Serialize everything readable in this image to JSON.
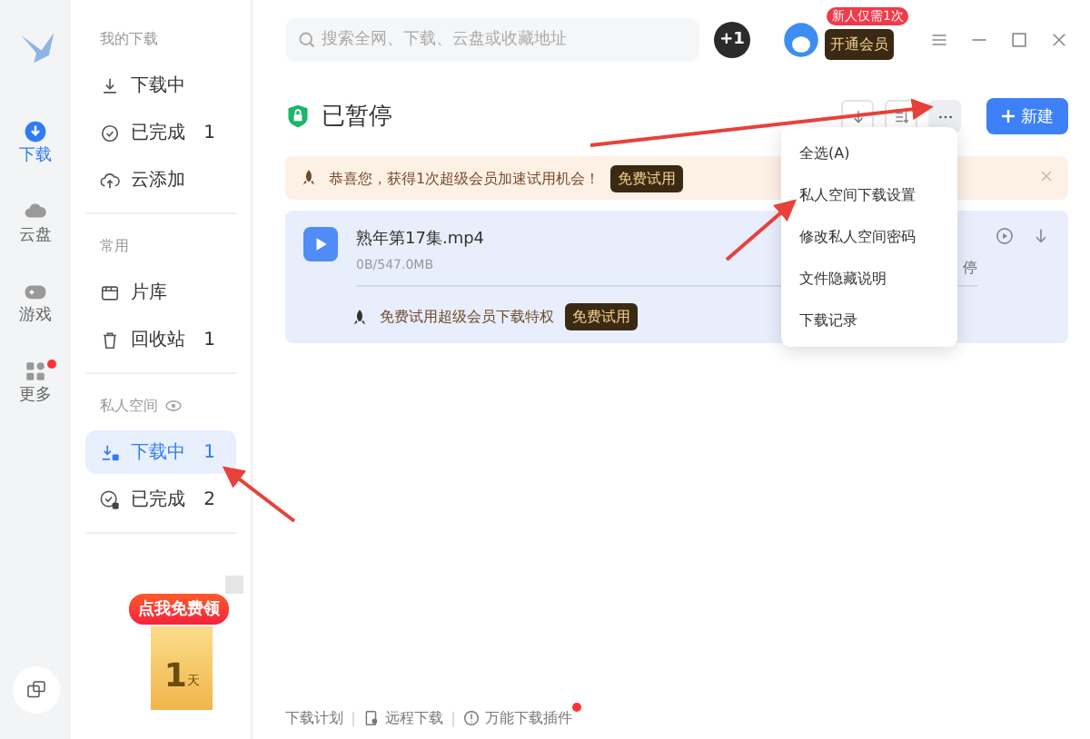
{
  "rail": [
    {
      "label": "下载",
      "kind": "download",
      "selected": true,
      "dot": false
    },
    {
      "label": "云盘",
      "kind": "cloud",
      "selected": false,
      "dot": false
    },
    {
      "label": "游戏",
      "kind": "game",
      "selected": false,
      "dot": false
    },
    {
      "label": "更多",
      "kind": "more",
      "selected": false,
      "dot": true
    }
  ],
  "sidebar": {
    "sections": [
      {
        "title": "我的下载",
        "items": [
          {
            "label": "下载中",
            "kind": "down",
            "selected": false
          },
          {
            "label": "已完成",
            "count": "1",
            "kind": "done",
            "selected": false
          },
          {
            "label": "云添加",
            "kind": "upload",
            "selected": false
          }
        ]
      },
      {
        "title": "常用",
        "items": [
          {
            "label": "片库",
            "kind": "film",
            "selected": false
          },
          {
            "label": "回收站",
            "count": "1",
            "kind": "trash",
            "selected": false
          }
        ]
      },
      {
        "title": "私人空间",
        "eye": true,
        "items": [
          {
            "label": "下载中",
            "count": "1",
            "kind": "lockdown",
            "selected": true
          },
          {
            "label": "已完成",
            "count": "2",
            "kind": "lockdone",
            "selected": false
          }
        ]
      }
    ],
    "promo": {
      "tag": "点我免费领",
      "number": "1",
      "unit": "天"
    }
  },
  "topbar": {
    "search": {
      "placeholder": "搜索全网、下载、云盘或收藏地址"
    },
    "badge": "+1",
    "vip_tag": "新人仅需1次",
    "vip_button": "开通会员"
  },
  "header": {
    "title": "已暂停",
    "new_button": "新建"
  },
  "banner": {
    "text": "恭喜您，获得1次超级会员加速试用机会！",
    "button": "免费试用"
  },
  "task": {
    "name": "熟年第17集.mp4",
    "size": "0B/547.0MB",
    "status": "停",
    "promo": "免费试用超级会员下载特权",
    "promo_button": "免费试用"
  },
  "menu": [
    "全选(A)",
    "私人空间下载设置",
    "修改私人空间密码",
    "文件隐藏说明",
    "下载记录"
  ],
  "footer": [
    {
      "label": "下载计划",
      "kind": "plain",
      "dot": false
    },
    {
      "label": "远程下载",
      "kind": "remote",
      "dot": false
    },
    {
      "label": "万能下载插件",
      "kind": "plugin",
      "dot": true
    }
  ]
}
